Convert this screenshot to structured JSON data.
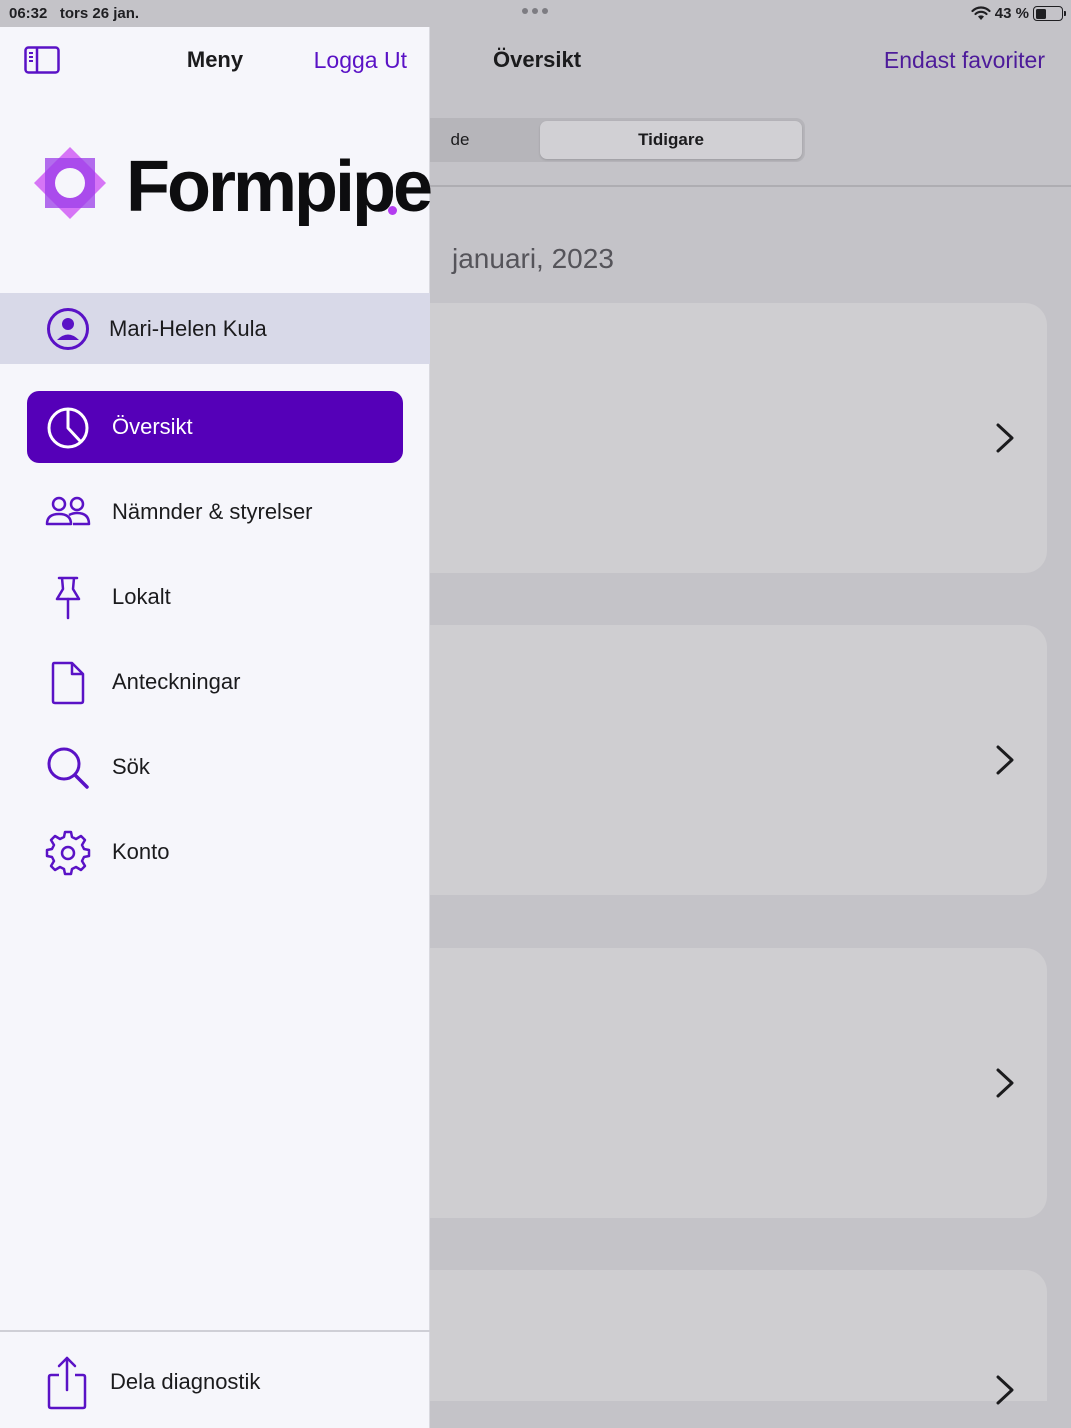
{
  "status_bar": {
    "time": "06:32",
    "date": "tors 26 jan.",
    "battery": "43 %",
    "battery_level": 0.43
  },
  "main": {
    "title": "Översikt",
    "favorites_button": "Endast favoriter",
    "segments": [
      "de",
      "Tidigare"
    ],
    "selected_segment": "Tidigare",
    "month_header": "januari, 2023"
  },
  "sidebar": {
    "title": "Meny",
    "logout": "Logga Ut",
    "logo_text": "Formpipe",
    "user_name": "Mari-Helen Kula",
    "items": [
      {
        "label": "Översikt",
        "icon": "pie-chart-icon",
        "active": true
      },
      {
        "label": "Nämnder & styrelser",
        "icon": "people-icon",
        "active": false
      },
      {
        "label": "Lokalt",
        "icon": "pin-icon",
        "active": false
      },
      {
        "label": "Anteckningar",
        "icon": "document-icon",
        "active": false
      },
      {
        "label": "Sök",
        "icon": "search-icon",
        "active": false
      },
      {
        "label": "Konto",
        "icon": "gear-icon",
        "active": false
      }
    ],
    "share": "Dela diagnostik"
  },
  "colors": {
    "accent": "#5500b8",
    "link": "#5a12c6",
    "logo_magenta": "#b43cf0"
  }
}
